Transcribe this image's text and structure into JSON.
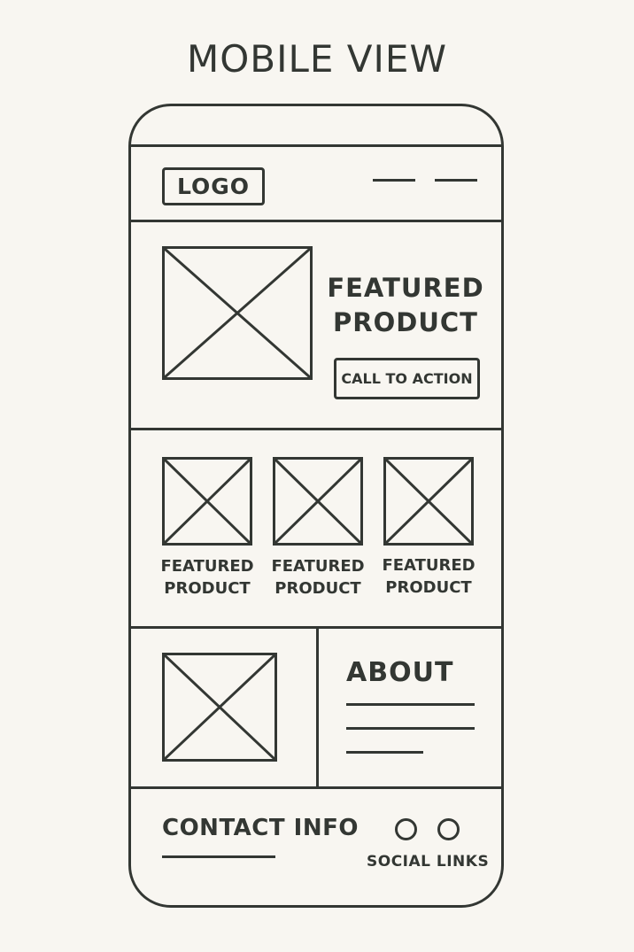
{
  "title": "MOBILE VIEW",
  "header": {
    "logo": "LOGO",
    "menu_icon": "hamburger-menu-icon"
  },
  "hero": {
    "image_icon": "image-placeholder-icon",
    "heading_line1": "FEATURED",
    "heading_line2": "PRODUCT",
    "cta_label": "CALL TO ACTION"
  },
  "featured": {
    "items": [
      {
        "line1": "FEATURED",
        "line2": "PRODUCT"
      },
      {
        "line1": "FEATURED",
        "line2": "PRODUCT"
      },
      {
        "line1": "FEATURED",
        "line2": "PRODUCT"
      }
    ]
  },
  "about": {
    "title": "ABOUT"
  },
  "footer": {
    "contact": "CONTACT INFO",
    "social_label": "SOCIAL LINKS",
    "social_icons": [
      "circle-icon",
      "circle-icon"
    ]
  },
  "colors": {
    "ink": "#333733",
    "paper": "#f8f6f1"
  }
}
